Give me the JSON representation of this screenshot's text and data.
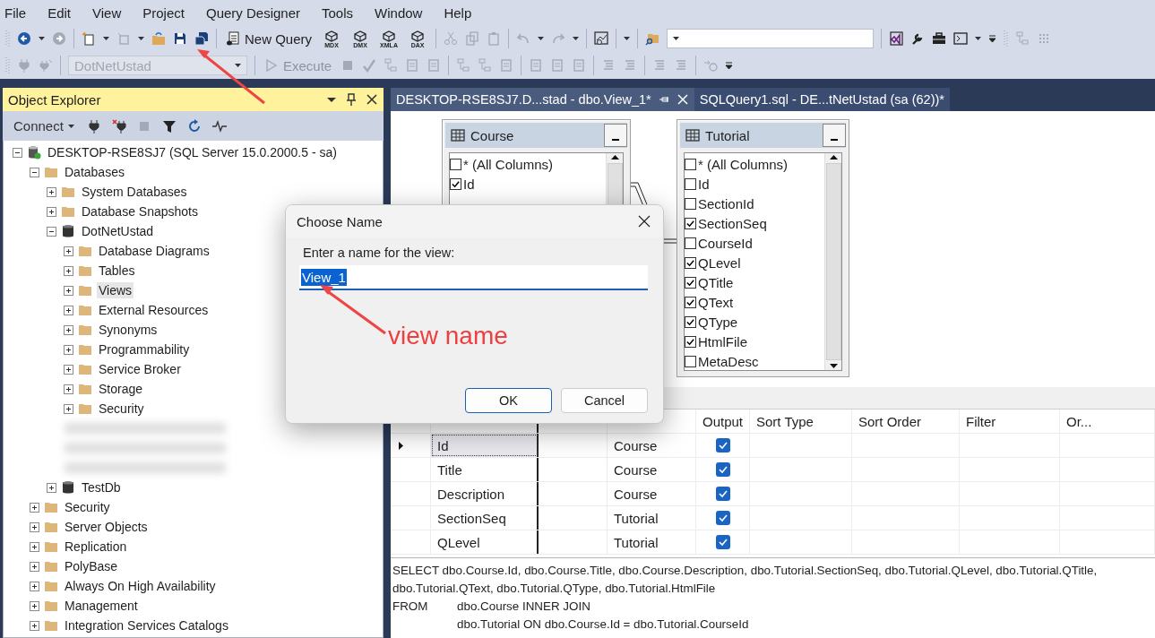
{
  "menu": [
    "File",
    "Edit",
    "View",
    "Project",
    "Query Designer",
    "Tools",
    "Window",
    "Help"
  ],
  "toolbar": {
    "new_query": "New Query",
    "query_types": [
      "MDX",
      "DMX",
      "XMLA",
      "DAX"
    ],
    "database": {
      "value": "DotNetUstad",
      "disabled": true
    },
    "execute": {
      "label": "Execute",
      "disabled": true
    }
  },
  "object_explorer": {
    "title": "Object Explorer",
    "connect": "Connect",
    "tree": [
      {
        "label": "DESKTOP-RSE8SJ7 (SQL Server 15.0.2000.5 - sa)",
        "kind": "server",
        "expanded": true,
        "selected": false,
        "children": [
          {
            "label": "Databases",
            "kind": "folder",
            "expanded": true,
            "selected": false,
            "children": [
              {
                "label": "System Databases",
                "kind": "folder",
                "expanded": false,
                "selected": false
              },
              {
                "label": "Database Snapshots",
                "kind": "folder",
                "expanded": false,
                "selected": false
              },
              {
                "label": "DotNetUstad",
                "kind": "database",
                "expanded": true,
                "selected": false,
                "children": [
                  {
                    "label": "Database Diagrams",
                    "kind": "folder",
                    "expanded": false,
                    "selected": false
                  },
                  {
                    "label": "Tables",
                    "kind": "folder",
                    "expanded": false,
                    "selected": false
                  },
                  {
                    "label": "Views",
                    "kind": "folder",
                    "expanded": false,
                    "selected": true
                  },
                  {
                    "label": "External Resources",
                    "kind": "folder",
                    "expanded": false,
                    "selected": false
                  },
                  {
                    "label": "Synonyms",
                    "kind": "folder",
                    "expanded": false,
                    "selected": false
                  },
                  {
                    "label": "Programmability",
                    "kind": "folder",
                    "expanded": false,
                    "selected": false
                  },
                  {
                    "label": "Service Broker",
                    "kind": "folder",
                    "expanded": false,
                    "selected": false
                  },
                  {
                    "label": "Storage",
                    "kind": "folder",
                    "expanded": false,
                    "selected": false
                  },
                  {
                    "label": "Security",
                    "kind": "folder",
                    "expanded": false,
                    "selected": false
                  }
                ]
              },
              {
                "kind": "blurred"
              },
              {
                "kind": "blurred"
              },
              {
                "kind": "blurred"
              },
              {
                "label": "TestDb",
                "kind": "database",
                "expanded": false,
                "selected": false
              }
            ]
          },
          {
            "label": "Security",
            "kind": "folder",
            "expanded": false,
            "selected": false
          },
          {
            "label": "Server Objects",
            "kind": "folder",
            "expanded": false,
            "selected": false
          },
          {
            "label": "Replication",
            "kind": "folder",
            "expanded": false,
            "selected": false
          },
          {
            "label": "PolyBase",
            "kind": "folder",
            "expanded": false,
            "selected": false
          },
          {
            "label": "Always On High Availability",
            "kind": "folder",
            "expanded": false,
            "selected": false
          },
          {
            "label": "Management",
            "kind": "folder",
            "expanded": false,
            "selected": false
          },
          {
            "label": "Integration Services Catalogs",
            "kind": "folder",
            "expanded": false,
            "selected": false
          }
        ]
      }
    ]
  },
  "tabs": [
    {
      "label": "DESKTOP-RSE8SJ7.D...stad - dbo.View_1*",
      "selected": true
    },
    {
      "label": "SQLQuery1.sql - DE...tNetUstad (sa (62))*",
      "selected": false
    }
  ],
  "designer": {
    "tables": [
      {
        "name": "Course",
        "columns": [
          {
            "name": "* (All Columns)",
            "checked": false
          },
          {
            "name": "Id",
            "checked": true
          }
        ]
      },
      {
        "name": "Tutorial",
        "columns": [
          {
            "name": "* (All Columns)",
            "checked": false
          },
          {
            "name": "Id",
            "checked": false
          },
          {
            "name": "SectionId",
            "checked": false
          },
          {
            "name": "SectionSeq",
            "checked": true
          },
          {
            "name": "CourseId",
            "checked": false
          },
          {
            "name": "QLevel",
            "checked": true
          },
          {
            "name": "QTitle",
            "checked": true
          },
          {
            "name": "QText",
            "checked": true
          },
          {
            "name": "QType",
            "checked": true
          },
          {
            "name": "HtmlFile",
            "checked": true
          },
          {
            "name": "MetaDesc",
            "checked": false
          }
        ]
      }
    ]
  },
  "grid": {
    "columns": [
      "Output",
      "Sort Type",
      "Sort Order",
      "Filter",
      "Or..."
    ],
    "rows": [
      {
        "column": "Id",
        "table": "Course",
        "output": true,
        "selected": true
      },
      {
        "column": "Title",
        "table": "Course",
        "output": true,
        "selected": false
      },
      {
        "column": "Description",
        "table": "Course",
        "output": true,
        "selected": false
      },
      {
        "column": "SectionSeq",
        "table": "Tutorial",
        "output": true,
        "selected": false
      },
      {
        "column": "QLevel",
        "table": "Tutorial",
        "output": true,
        "selected": false
      }
    ]
  },
  "sql": {
    "lines": [
      {
        "text": "SELECT dbo.Course.Id, dbo.Course.Title, dbo.Course.Description, dbo.Tutorial.SectionSeq, dbo.Tutorial.QLevel, dbo.Tutorial.QTitle,"
      },
      {
        "text": "dbo.Tutorial.QText, dbo.Tutorial.QType, dbo.Tutorial.HtmlFile"
      },
      {
        "keyword": "FROM",
        "text": "dbo.Course INNER JOIN"
      },
      {
        "text": "dbo.Tutorial ON dbo.Course.Id = dbo.Tutorial.CourseId",
        "indented": true
      }
    ]
  },
  "dialog": {
    "title": "Choose Name",
    "prompt": "Enter a name for the view:",
    "value": "View_1",
    "text_selected": true,
    "buttons": [
      {
        "label": "OK",
        "default": true
      },
      {
        "label": "Cancel",
        "default": false
      }
    ]
  },
  "annotation": {
    "text": "view name"
  }
}
